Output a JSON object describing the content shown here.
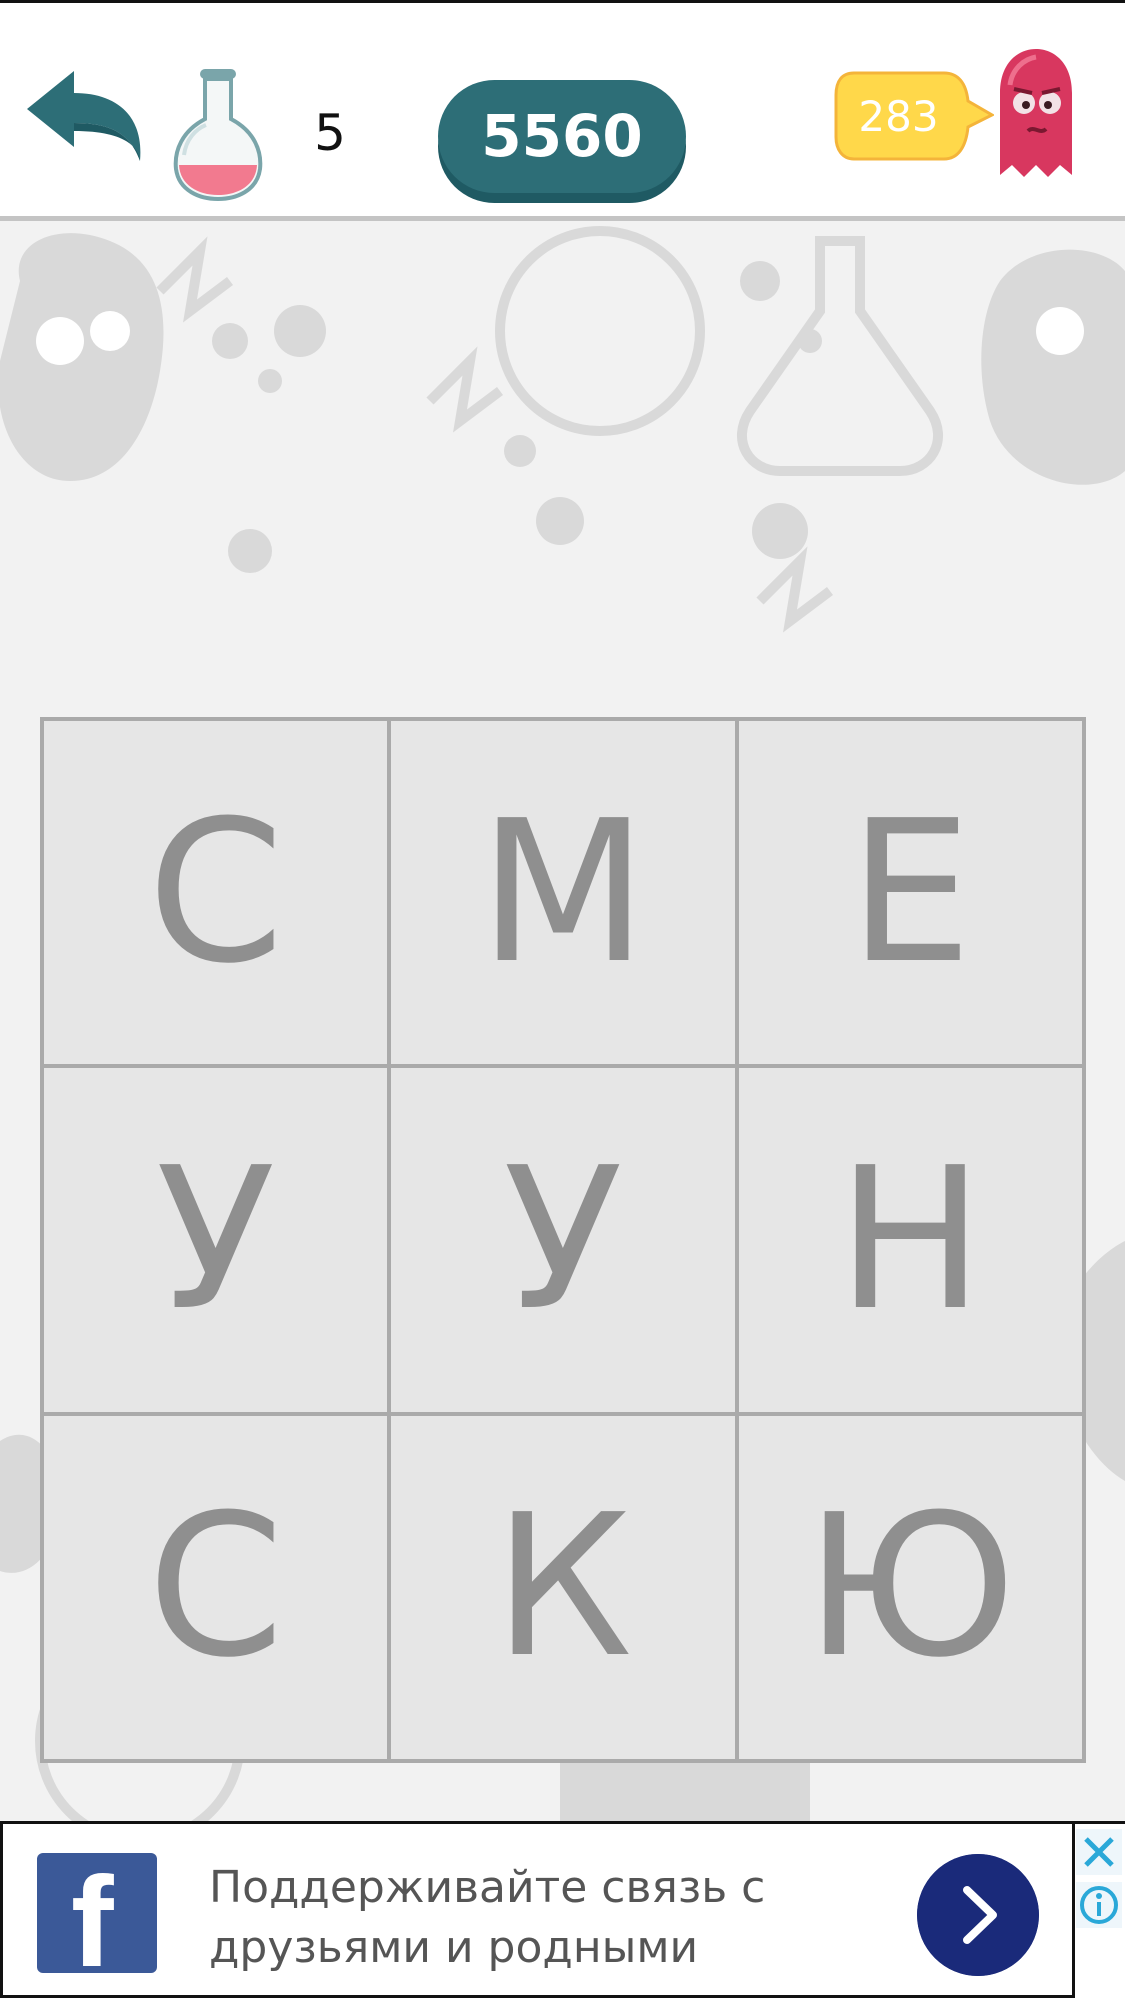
{
  "header": {
    "hint_count": "5",
    "score": "5560",
    "opponent_points": "283"
  },
  "board": {
    "tiles": [
      "С",
      "М",
      "Е",
      "У",
      "У",
      "Н",
      "С",
      "К",
      "Ю"
    ]
  },
  "ad": {
    "line1": "Поддерживайте связь с",
    "line2": "друзьями и родными",
    "logo_letter": "f"
  },
  "colors": {
    "accent_teal": "#2d6e77",
    "bubble_yellow": "#ffd84a",
    "ghost_pink": "#d8375f",
    "tile_bg": "#e6e6e6",
    "tile_text": "#8f8f8f",
    "facebook_blue": "#3b5998",
    "ad_button": "#1a2a7a"
  },
  "icons": {
    "back": "back-arrow-icon",
    "flask": "flask-icon",
    "ghost": "monster-avatar-icon",
    "ad_next": "chevron-right-icon",
    "ad_close": "close-icon",
    "ad_info": "info-icon"
  }
}
